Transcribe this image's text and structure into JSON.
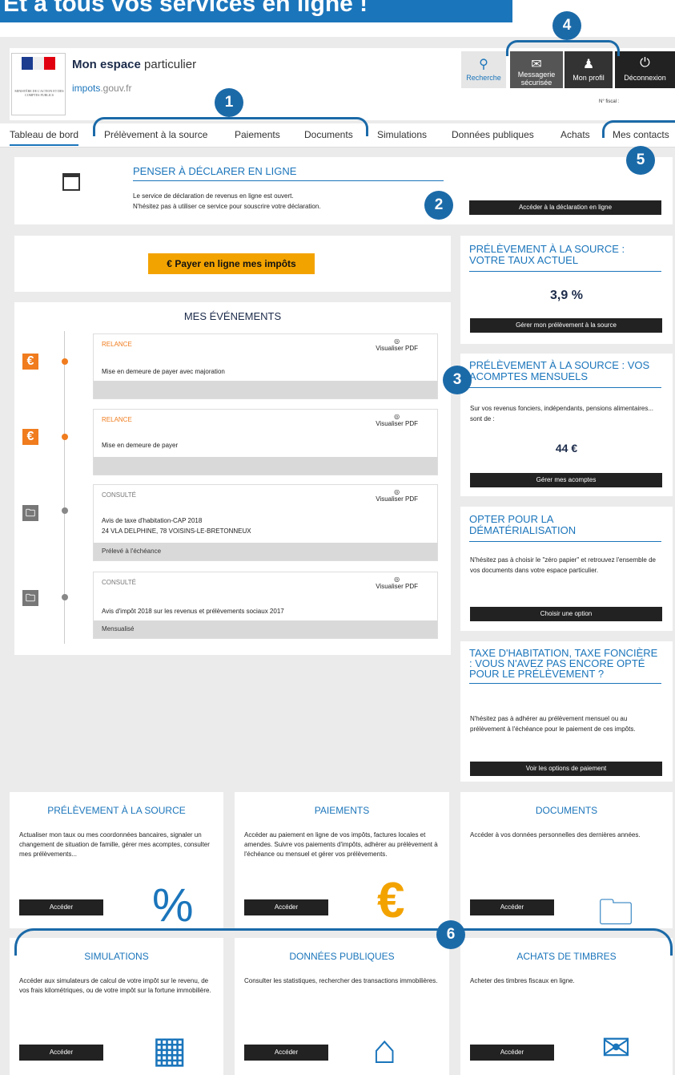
{
  "banner": "Et à tous vos services en ligne !",
  "header": {
    "brand_bold": "Mon espace",
    "brand_rest": " particulier",
    "site": "impots",
    "site_suffix": ".gouv.fr",
    "logo_text": "MINISTÈRE DE L'ACTION ET DES COMPTES PUBLICS",
    "fiscal_label": "N° fiscal :",
    "buttons": [
      {
        "label": "Recherche",
        "icon": "search-icon"
      },
      {
        "label": "Messagerie sécurisée",
        "icon": "mail-icon"
      },
      {
        "label": "Mon profil",
        "icon": "user-icon"
      },
      {
        "label": "Déconnexion",
        "icon": "power-icon"
      }
    ]
  },
  "nav": [
    "Tableau de bord",
    "Prélèvement à la source",
    "Paiements",
    "Documents",
    "Simulations",
    "Données publiques",
    "Achats",
    "Mes contacts"
  ],
  "declare": {
    "title": "PENSER À DÉCLARER EN LIGNE",
    "line1": "Le service de déclaration de revenus en ligne est ouvert.",
    "line2": "N'hésitez pas à utiliser ce service pour souscrire votre déclaration.",
    "button": "Accéder à la déclaration en ligne"
  },
  "pay": {
    "symbol": "€",
    "label": "Payer en ligne mes impôts"
  },
  "events": {
    "title": "MES ÉVÉNEMENTS",
    "pdf": "Visualiser PDF",
    "items": [
      {
        "status": "RELANCE",
        "text": "Mise en demeure de payer avec majoration",
        "text2": "",
        "footer": ""
      },
      {
        "status": "RELANCE",
        "text": "Mise en demeure de payer",
        "text2": "",
        "footer": ""
      },
      {
        "status": "CONSULTÉ",
        "text": "Avis de taxe d'habitation-CAP 2018",
        "text2": "24 VLA DELPHINE, 78 VOISINS-LE-BRETONNEUX",
        "footer": "Prélevé à l'échéance"
      },
      {
        "status": "CONSULTÉ",
        "text": "Avis d'impôt 2018 sur les revenus et prélèvements sociaux 2017",
        "text2": "",
        "footer": "Mensualisé"
      }
    ]
  },
  "side": {
    "rate": {
      "title": "PRÉLÈVEMENT À LA SOURCE : VOTRE TAUX ACTUEL",
      "value": "3,9 %",
      "button": "Gérer mon prélèvement à la source"
    },
    "acomptes": {
      "title": "PRÉLÈVEMENT À LA SOURCE : VOS ACOMPTES MENSUELS",
      "desc": "Sur vos revenus fonciers, indépendants, pensions alimentaires... sont de :",
      "value": "44 €",
      "button": "Gérer mes acomptes"
    },
    "demat": {
      "title": "OPTER POUR LA DÉMATÉRIALISATION",
      "desc": "N'hésitez pas à choisir le \"zéro papier\" et retrouvez l'ensemble de vos documents dans votre espace particulier.",
      "button": "Choisir une option"
    },
    "taxe": {
      "title": "TAXE D'HABITATION, TAXE FONCIÈRE : VOUS N'AVEZ PAS ENCORE OPTÉ POUR LE PRÉLÈVEMENT ?",
      "desc": "N'hésitez pas à adhérer au prélèvement mensuel ou au prélèvement à l'échéance pour le paiement de ces impôts.",
      "button": "Voir les options de paiement"
    }
  },
  "cards": [
    {
      "title": "PRÉLÈVEMENT À LA SOURCE",
      "desc": "Actualiser mon taux ou mes coordonnées bancaires, signaler un changement de situation de famille, gérer mes acomptes, consulter mes prélèvements...",
      "button": "Accéder",
      "icon": "%",
      "icon_name": "percent-icon"
    },
    {
      "title": "PAIEMENTS",
      "desc": "Accéder au paiement en ligne de vos impôts, factures locales et amendes. Suivre vos paiements d'impôts, adhérer au prélèvement à l'échéance ou mensuel et gérer vos prélèvements.",
      "button": "Accéder",
      "icon": "€",
      "icon_name": "euro-icon"
    },
    {
      "title": "DOCUMENTS",
      "desc": "Accéder à vos données personnelles des dernières années.",
      "button": "Accéder",
      "icon": "🗀",
      "icon_name": "folder-icon"
    },
    {
      "title": "SIMULATIONS",
      "desc": "Accéder aux simulateurs de calcul de votre impôt sur le revenu, de vos frais kilométriques, ou de votre impôt sur la fortune immobilière.",
      "button": "Accéder",
      "icon": "▦",
      "icon_name": "calculator-icon"
    },
    {
      "title": "DONNÉES PUBLIQUES",
      "desc": "Consulter les statistiques, rechercher des transactions immobilières.",
      "button": "Accéder",
      "icon": "⌂",
      "icon_name": "house-icon"
    },
    {
      "title": "ACHATS DE TIMBRES",
      "desc": "Acheter des timbres fiscaux en ligne.",
      "button": "Accéder",
      "icon": "✉",
      "icon_name": "stamp-icon"
    }
  ],
  "badges": [
    "1",
    "2",
    "3",
    "4",
    "5",
    "6"
  ],
  "colors": {
    "accent": "#1b75bb",
    "badge": "#1b6aa8",
    "orange": "#f3a300",
    "relance": "#f07c1e"
  }
}
